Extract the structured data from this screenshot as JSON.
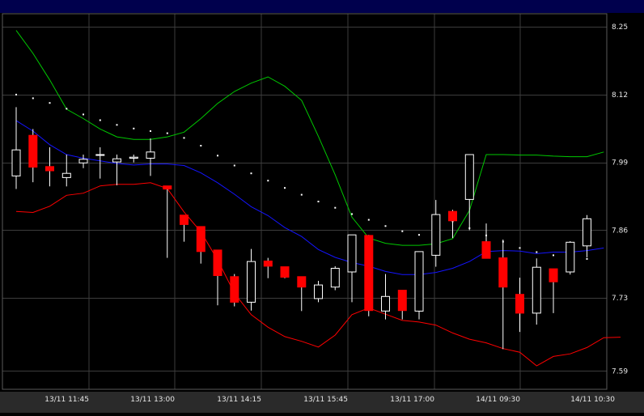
{
  "chart_data": {
    "type": "candlestick",
    "title": "",
    "xlabel": "",
    "ylabel": "",
    "ylim": [
      7.555,
      8.275
    ],
    "grid": true,
    "x_tick_labels": [
      "13/11 11:45",
      "13/11 13:00",
      "13/11 14:15",
      "13/11 15:45",
      "13/11 17:00",
      "14/11 09:30",
      "14/11 10:30"
    ],
    "y_tick_labels": [
      "8.25",
      "8.12",
      "7.99",
      "7.86",
      "7.73",
      "7.59"
    ],
    "colors": {
      "up_candle": "#ffffff",
      "down_candle": "#ff0000",
      "upper_band": "#00c800",
      "middle_band": "#1414ff",
      "lower_band": "#ff0000",
      "parabolic_sar": "#ffffff",
      "grid": "#3c3c3c"
    },
    "candles": [
      {
        "o": 7.964,
        "h": 8.096,
        "l": 7.939,
        "c": 8.014
      },
      {
        "o": 8.042,
        "h": 8.054,
        "l": 7.952,
        "c": 7.981
      },
      {
        "o": 7.982,
        "h": 8.019,
        "l": 7.944,
        "c": 7.974
      },
      {
        "o": 7.961,
        "h": 8.005,
        "l": 7.944,
        "c": 7.969
      },
      {
        "o": 7.989,
        "h": 8.005,
        "l": 7.979,
        "c": 7.996
      },
      {
        "o": 8.005,
        "h": 8.019,
        "l": 7.959,
        "c": 8.005
      },
      {
        "o": 7.991,
        "h": 8.005,
        "l": 7.946,
        "c": 7.997
      },
      {
        "o": 7.998,
        "h": 8.005,
        "l": 7.99,
        "c": 8.0
      },
      {
        "o": 7.998,
        "h": 8.036,
        "l": 7.964,
        "c": 8.01
      },
      {
        "o": 7.945,
        "h": 7.945,
        "l": 7.807,
        "c": 7.939
      },
      {
        "o": 7.889,
        "h": 7.889,
        "l": 7.838,
        "c": 7.871
      },
      {
        "o": 7.867,
        "h": 7.867,
        "l": 7.796,
        "c": 7.819
      },
      {
        "o": 7.822,
        "h": 7.822,
        "l": 7.716,
        "c": 7.773
      },
      {
        "o": 7.771,
        "h": 7.776,
        "l": 7.714,
        "c": 7.722
      },
      {
        "o": 7.722,
        "h": 7.824,
        "l": 7.706,
        "c": 7.8
      },
      {
        "o": 7.801,
        "h": 7.807,
        "l": 7.768,
        "c": 7.791
      },
      {
        "o": 7.79,
        "h": 7.79,
        "l": 7.768,
        "c": 7.77
      },
      {
        "o": 7.771,
        "h": 7.771,
        "l": 7.705,
        "c": 7.751
      },
      {
        "o": 7.729,
        "h": 7.763,
        "l": 7.722,
        "c": 7.755
      },
      {
        "o": 7.751,
        "h": 7.791,
        "l": 7.745,
        "c": 7.787
      },
      {
        "o": 7.78,
        "h": 7.851,
        "l": 7.722,
        "c": 7.851
      },
      {
        "o": 7.85,
        "h": 7.851,
        "l": 7.695,
        "c": 7.706
      },
      {
        "o": 7.705,
        "h": 7.776,
        "l": 7.689,
        "c": 7.733
      },
      {
        "o": 7.745,
        "h": 7.745,
        "l": 7.689,
        "c": 7.706
      },
      {
        "o": 7.705,
        "h": 7.816,
        "l": 7.689,
        "c": 7.819
      },
      {
        "o": 7.812,
        "h": 7.918,
        "l": 7.79,
        "c": 7.89
      },
      {
        "o": 7.896,
        "h": 7.899,
        "l": 7.845,
        "c": 7.878
      },
      {
        "o": 7.919,
        "h": 8.005,
        "l": 7.86,
        "c": 8.005
      },
      {
        "o": 7.838,
        "h": 7.873,
        "l": 7.806,
        "c": 7.806
      },
      {
        "o": 7.807,
        "h": 7.842,
        "l": 7.632,
        "c": 7.751
      },
      {
        "o": 7.737,
        "h": 7.769,
        "l": 7.665,
        "c": 7.701
      },
      {
        "o": 7.701,
        "h": 7.806,
        "l": 7.679,
        "c": 7.789
      },
      {
        "o": 7.786,
        "h": 7.786,
        "l": 7.701,
        "c": 7.761
      },
      {
        "o": 7.78,
        "h": 7.839,
        "l": 7.775,
        "c": 7.837
      },
      {
        "o": 7.83,
        "h": 7.889,
        "l": 7.808,
        "c": 7.882
      }
    ],
    "upper_band": [
      8.243,
      8.199,
      8.148,
      8.092,
      8.074,
      8.054,
      8.039,
      8.034,
      8.034,
      8.039,
      8.048,
      8.074,
      8.103,
      8.126,
      8.142,
      8.154,
      8.136,
      8.109,
      8.04,
      7.966,
      7.885,
      7.845,
      7.835,
      7.831,
      7.831,
      7.834,
      7.844,
      7.898,
      8.005,
      8.005,
      8.004,
      8.004,
      8.002,
      8.001,
      8.001,
      8.01
    ],
    "middle_band": [
      8.07,
      8.05,
      8.024,
      8.005,
      7.998,
      7.993,
      7.988,
      7.985,
      7.987,
      7.987,
      7.984,
      7.97,
      7.951,
      7.929,
      7.905,
      7.888,
      7.865,
      7.848,
      7.823,
      7.808,
      7.798,
      7.791,
      7.781,
      7.775,
      7.775,
      7.779,
      7.787,
      7.8,
      7.819,
      7.821,
      7.82,
      7.815,
      7.818,
      7.818,
      7.821,
      7.826
    ],
    "lower_band": [
      7.896,
      7.894,
      7.906,
      7.927,
      7.931,
      7.945,
      7.948,
      7.948,
      7.951,
      7.94,
      7.895,
      7.857,
      7.803,
      7.739,
      7.698,
      7.674,
      7.656,
      7.647,
      7.636,
      7.659,
      7.698,
      7.711,
      7.699,
      7.687,
      7.684,
      7.678,
      7.663,
      7.651,
      7.644,
      7.633,
      7.626,
      7.6,
      7.618,
      7.623,
      7.635,
      7.654,
      7.655
    ],
    "parabolic_sar": [
      8.12,
      8.113,
      8.104,
      8.093,
      8.082,
      8.071,
      8.062,
      8.055,
      8.05,
      8.046,
      8.037,
      8.022,
      8.003,
      7.984,
      7.969,
      7.955,
      7.941,
      7.928,
      7.915,
      7.903,
      7.891,
      7.88,
      7.868,
      7.858,
      7.851,
      7.857,
      7.877,
      7.864,
      7.85,
      7.838,
      7.826,
      7.818,
      7.812,
      7.809,
      7.805
    ]
  }
}
